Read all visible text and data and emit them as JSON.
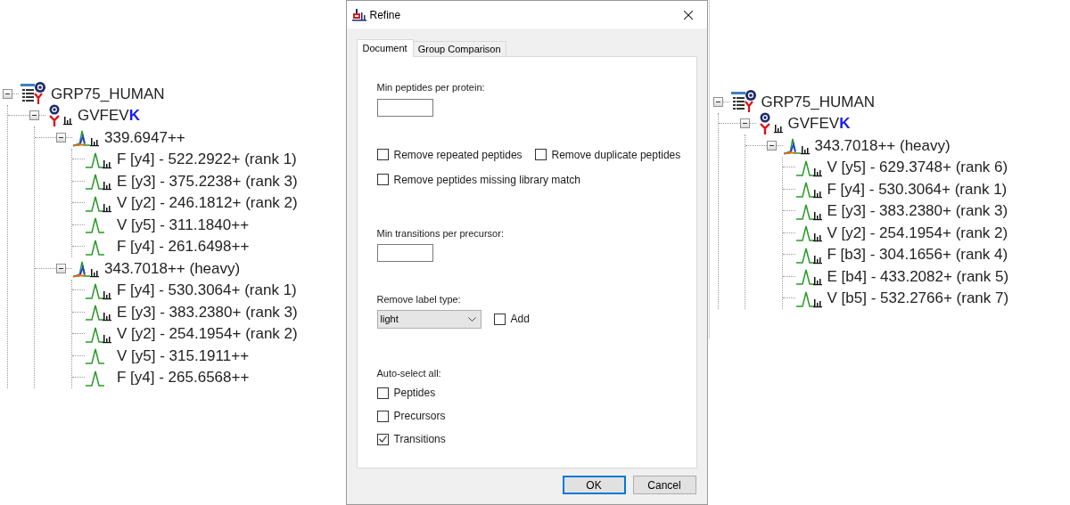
{
  "left_tree": {
    "nodes": [
      {
        "kind": "protein",
        "text": "GRP75_HUMAN",
        "expanded": true,
        "children": [
          {
            "kind": "peptide",
            "text": "GVFEV**K**",
            "expanded": true,
            "children": [
              {
                "kind": "precursor",
                "text": "339.6947++",
                "expanded": true,
                "children": [
                  {
                    "kind": "transition",
                    "text": "F [y4] - 522.2922+ (rank 1)",
                    "library_match": true
                  },
                  {
                    "kind": "transition",
                    "text": "E [y3] - 375.2238+ (rank 3)",
                    "library_match": true
                  },
                  {
                    "kind": "transition",
                    "text": "V [y2] - 246.1812+ (rank 2)",
                    "library_match": true
                  },
                  {
                    "kind": "transition",
                    "text": "V [y5] - 311.1840++",
                    "library_match": false
                  },
                  {
                    "kind": "transition",
                    "text": "F [y4] - 261.6498++",
                    "library_match": false
                  }
                ]
              },
              {
                "kind": "precursor",
                "text": "343.7018++ (heavy)",
                "expanded": true,
                "children": [
                  {
                    "kind": "transition",
                    "text": "F [y4] - 530.3064+ (rank 1)",
                    "library_match": true
                  },
                  {
                    "kind": "transition",
                    "text": "E [y3] - 383.2380+ (rank 3)",
                    "library_match": true
                  },
                  {
                    "kind": "transition",
                    "text": "V [y2] - 254.1954+ (rank 2)",
                    "library_match": true
                  },
                  {
                    "kind": "transition",
                    "text": "V [y5] - 315.1911++",
                    "library_match": false
                  },
                  {
                    "kind": "transition",
                    "text": "F [y4] - 265.6568++",
                    "library_match": false
                  }
                ]
              }
            ]
          }
        ]
      }
    ]
  },
  "dialog": {
    "title": "Refine",
    "tabs": [
      {
        "label": "Document",
        "selected": true
      },
      {
        "label": "Group Comparison",
        "selected": false
      }
    ],
    "min_peptides": {
      "label": "Min peptides per protein:"
    },
    "remove_options": [
      {
        "label": "Remove repeated peptides",
        "checked": false
      },
      {
        "label": "Remove duplicate peptides",
        "checked": false
      },
      {
        "label": "Remove peptides missing library match",
        "checked": false
      }
    ],
    "min_transitions": {
      "label": "Min transitions per precursor:"
    },
    "remove_label_type": {
      "label": "Remove label type:",
      "value": "light",
      "add": {
        "label": "Add",
        "checked": false
      }
    },
    "auto_select": {
      "label": "Auto-select all:",
      "options": [
        {
          "label": "Peptides",
          "checked": false
        },
        {
          "label": "Precursors",
          "checked": false
        },
        {
          "label": "Transitions",
          "checked": true
        }
      ]
    },
    "buttons": [
      {
        "label": "OK",
        "default": true
      },
      {
        "label": "Cancel",
        "default": false
      }
    ]
  },
  "right_tree": {
    "nodes": [
      {
        "kind": "protein",
        "text": "GRP75_HUMAN",
        "expanded": true,
        "children": [
          {
            "kind": "peptide",
            "text": "GVFEV**K**",
            "expanded": true,
            "children": [
              {
                "kind": "precursor",
                "text": "343.7018++ (heavy)",
                "expanded": true,
                "children": [
                  {
                    "kind": "transition",
                    "text": "V [y5] - 629.3748+ (rank 6)",
                    "library_match": true
                  },
                  {
                    "kind": "transition",
                    "text": "F [y4] - 530.3064+ (rank 1)",
                    "library_match": true
                  },
                  {
                    "kind": "transition",
                    "text": "E [y3] - 383.2380+ (rank 3)",
                    "library_match": true
                  },
                  {
                    "kind": "transition",
                    "text": "V [y2] - 254.1954+ (rank 2)",
                    "library_match": true
                  },
                  {
                    "kind": "transition",
                    "text": "F [b3] - 304.1656+ (rank 4)",
                    "library_match": true
                  },
                  {
                    "kind": "transition",
                    "text": "E [b4] - 433.2082+ (rank 5)",
                    "library_match": true
                  },
                  {
                    "kind": "transition",
                    "text": "V [b5] - 532.2766+ (rank 7)",
                    "library_match": true
                  }
                ]
              }
            ]
          }
        ]
      }
    ]
  }
}
